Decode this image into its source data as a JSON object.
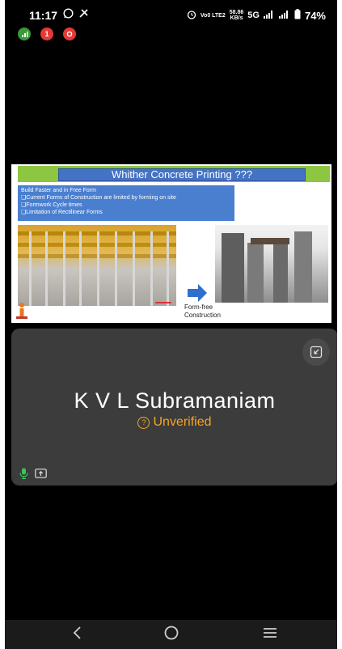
{
  "status_bar": {
    "time": "11:17",
    "net_label": "Vo0 LTE2",
    "speed_value": "58.86",
    "speed_unit": "KB/s",
    "network_type": "5G",
    "battery_percent": "74%"
  },
  "notifications": [
    "signal-stats-icon",
    "number-one-badge",
    "record-icon"
  ],
  "slide": {
    "title": "Whither Concrete Printing ???",
    "bullets": [
      "Build Faster and in Free Form",
      "❑Current Forms of Construction are limited by forming on site",
      "❑Formwork Cycle times",
      "❑Limitation of Rectilinear Forms"
    ],
    "caption_line1": "Form-free",
    "caption_line2": "Construction",
    "colors": {
      "title_bar": "#8dc640",
      "title_box": "#4472c4",
      "bullets_bg": "#4a7fd0"
    }
  },
  "participant": {
    "name": "K V L Subramaniam",
    "status": "Unverified",
    "status_color": "#f5a623"
  },
  "nav": {
    "back": "back-icon",
    "home": "home-icon",
    "menu": "recents-icon"
  }
}
